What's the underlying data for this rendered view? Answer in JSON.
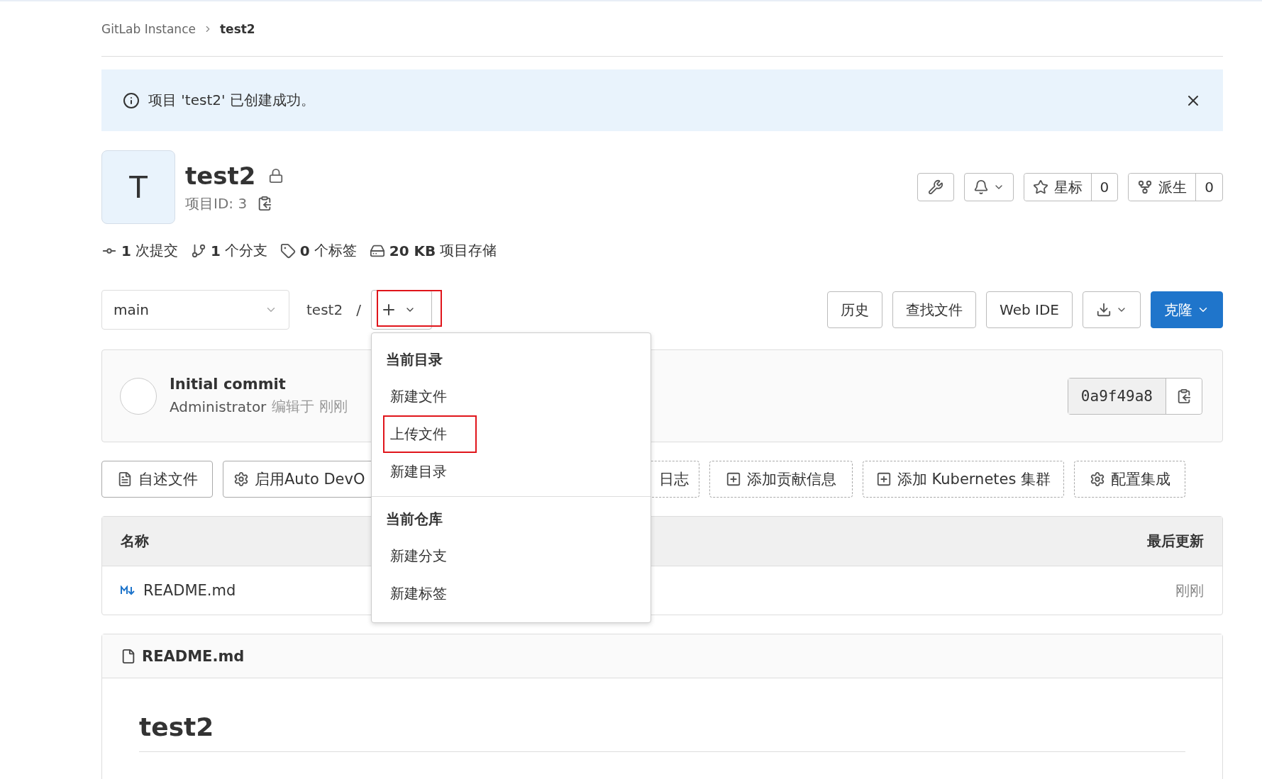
{
  "breadcrumb": [
    {
      "label": "GitLab Instance",
      "current": false
    },
    {
      "label": "test2",
      "current": true
    }
  ],
  "alert": {
    "message": "项目 'test2' 已创建成功。"
  },
  "project": {
    "avatar_letter": "T",
    "name": "test2",
    "id_label": "项目ID: 3"
  },
  "header_actions": {
    "star": {
      "label": "星标",
      "count": "0"
    },
    "fork": {
      "label": "派生",
      "count": "0"
    }
  },
  "stats": [
    {
      "kind": "commits",
      "value": "1",
      "label": "次提交"
    },
    {
      "kind": "branches",
      "value": "1",
      "label": "个分支"
    },
    {
      "kind": "tags",
      "value": "0",
      "label": "个标签"
    },
    {
      "kind": "storage",
      "value": "20 KB",
      "label": "项目存储"
    }
  ],
  "toolbar": {
    "branch": "main",
    "path": "test2",
    "separator": "/",
    "add_highlighted": true,
    "buttons": [
      "历史",
      "查找文件",
      "Web IDE"
    ],
    "clone": "克隆"
  },
  "commit": {
    "title": "Initial commit",
    "author": "Administrator",
    "meta": "编辑于 刚刚",
    "sha": "0a9f49a8"
  },
  "dropdown": {
    "sections": [
      {
        "heading": "当前目录",
        "items": [
          {
            "label": "新建文件",
            "highlighted": false
          },
          {
            "label": "上传文件",
            "highlighted": true
          },
          {
            "label": "新建目录",
            "highlighted": false
          }
        ]
      },
      {
        "heading": "当前仓库",
        "items": [
          {
            "label": "新建分支",
            "highlighted": false
          },
          {
            "label": "新建标签",
            "highlighted": false
          }
        ]
      }
    ]
  },
  "quick_actions": [
    {
      "kind": "file",
      "label": "自述文件"
    },
    {
      "kind": "gear",
      "label": "启用Auto DevO"
    },
    {
      "kind": "none",
      "label": "日志"
    },
    {
      "kind": "plus",
      "label": "添加贡献信息"
    },
    {
      "kind": "plus",
      "label": "添加 Kubernetes 集群"
    },
    {
      "kind": "gear",
      "label": "配置集成"
    }
  ],
  "table": {
    "columns": [
      "名称",
      "最后更新"
    ],
    "rows": [
      {
        "name": "README.md",
        "updated": "刚刚"
      }
    ]
  },
  "readme": {
    "filename": "README.md",
    "heading": "test2"
  }
}
